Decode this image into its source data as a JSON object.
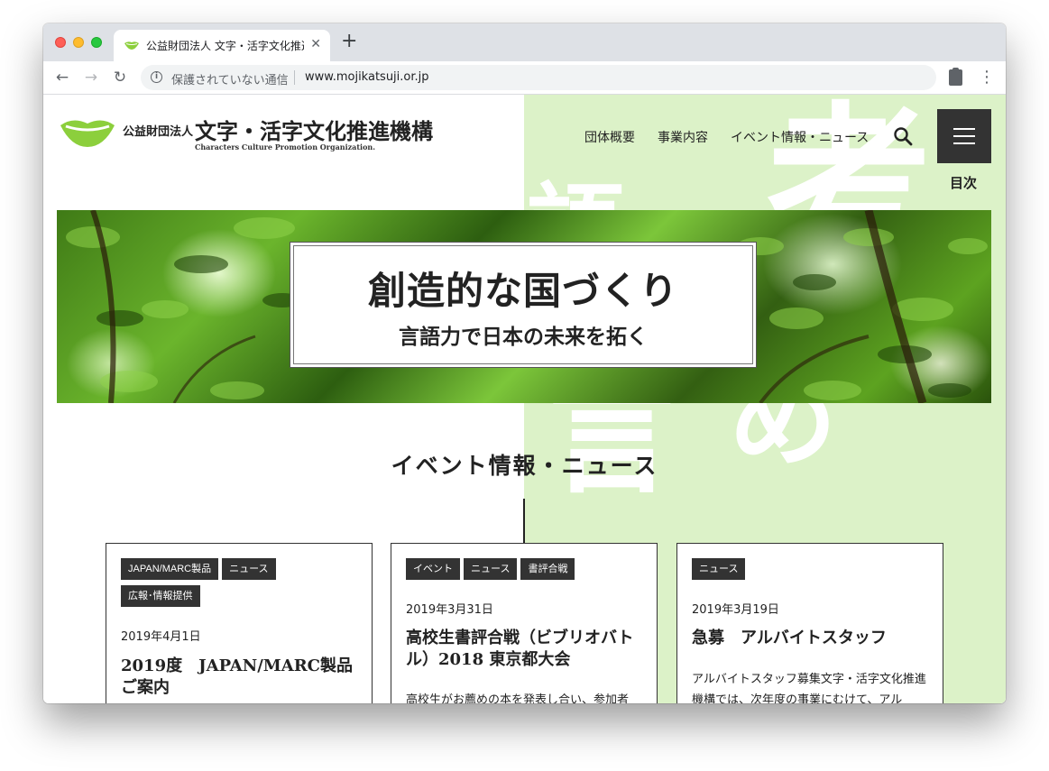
{
  "browser": {
    "tab_title": "公益財団法人 文字・活字文化推進機構",
    "tab_close": "✕",
    "new_tab": "+",
    "security_text": "保護されていない通信",
    "url": "www.mojikatsuji.or.jp"
  },
  "header": {
    "org_type": "公益財団法人",
    "org_name": "文字・活字文化推進機構",
    "org_name_en": "Characters Culture Promotion Organization.",
    "nav": [
      "団体概要",
      "事業内容",
      "イベント情報・ニュース"
    ],
    "menu_label": "目次"
  },
  "hero": {
    "title": "創造的な国づくり",
    "subtitle": "言語力で日本の未来を拓く"
  },
  "background_chars": [
    "考",
    "語",
    "言",
    "め"
  ],
  "section": {
    "title": "イベント情報・ニュース"
  },
  "cards": [
    {
      "tags": [
        "JAPAN/MARC製品",
        "ニュース",
        "広報･情報提供"
      ],
      "date": "2019年4月1日",
      "title": "2019度　JAPAN/MARC製品ご案内",
      "body": ""
    },
    {
      "tags": [
        "イベント",
        "ニュース",
        "書評合戦"
      ],
      "date": "2019年3月31日",
      "title": "高校生書評合戦（ビブリオバトル）2018 東京都大会",
      "body": "高校生がお薦めの本を発表し合い、参加者"
    },
    {
      "tags": [
        "ニュース"
      ],
      "date": "2019年3月19日",
      "title": "急募　アルバイトスタッフ",
      "body": "アルバイトスタッフ募集文字・活字文化推進機構では、次年度の事業にむけて、アル"
    }
  ],
  "colors": {
    "accent_green": "#8ccf3c",
    "panel_green": "#dcf2c8",
    "dark": "#333333"
  }
}
